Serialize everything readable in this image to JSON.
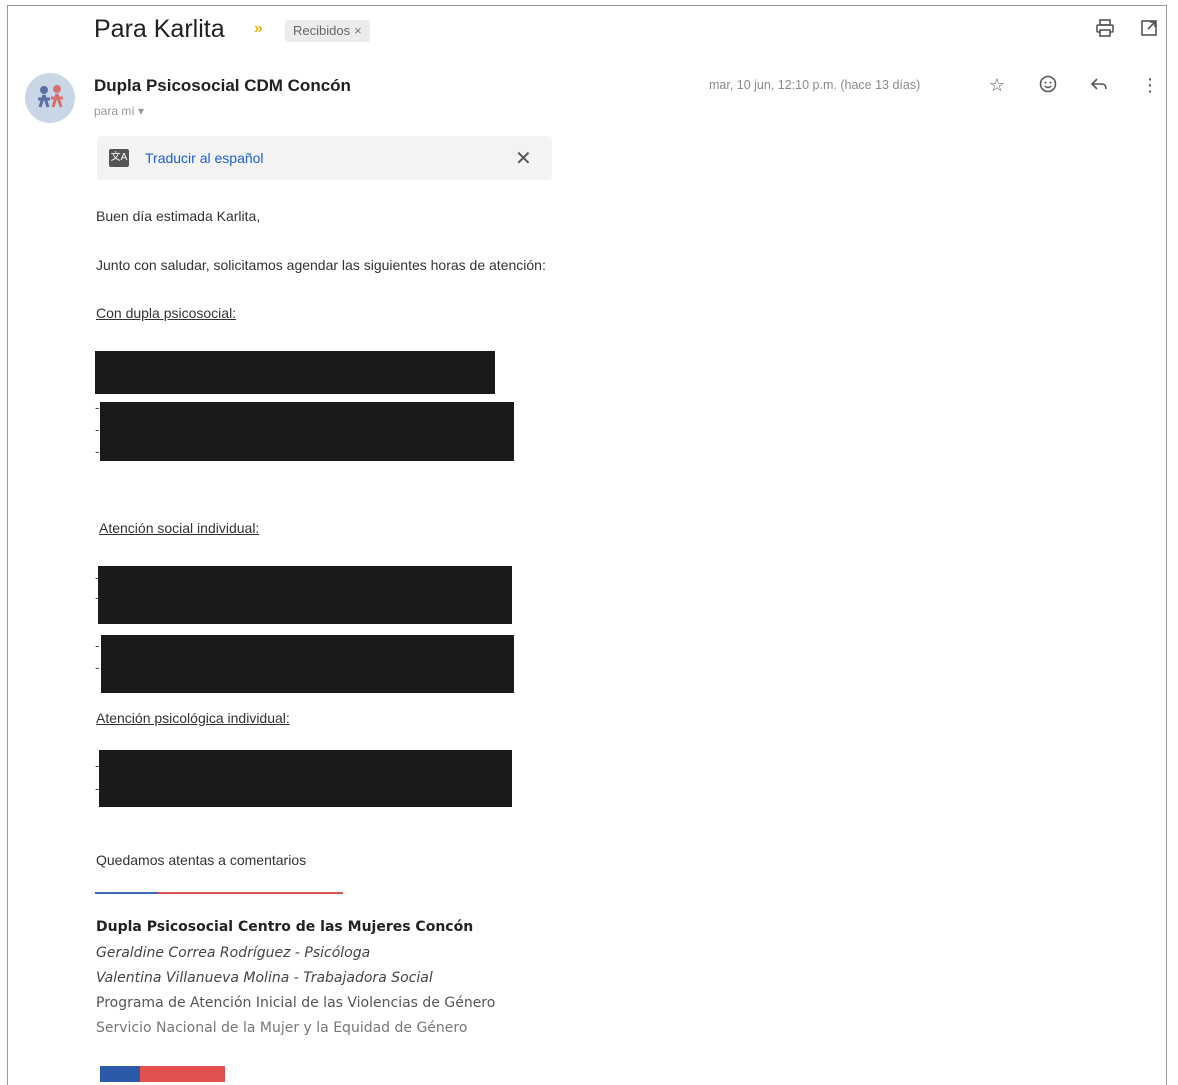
{
  "email": {
    "subject": "Para Karlita",
    "label": "Recibidos",
    "label_close": "×",
    "sender": "Dupla Psicosocial CDM Concón",
    "recipient": "para mí",
    "date": "mar, 10 jun, 12:10 p.m. (hace 13 días)"
  },
  "translate": {
    "link": "Traducir al español",
    "close": "✕"
  },
  "body": {
    "greeting": "Buen día estimada Karlita,",
    "intro": "Junto con saludar, solicitamos agendar las siguientes horas de atención:",
    "section1": "Con dupla psicosocial:",
    "section2": "Atención social individual:",
    "section3": "Atención psicológica individual:",
    "closing": "Quedamos atentas a comentarios"
  },
  "signature": {
    "line1": "Dupla Psicosocial Centro de las Mujeres Concón",
    "line2": "Geraldine Correa Rodríguez - Psicóloga",
    "line3": "Valentina Villanueva Molina - Trabajadora Social",
    "line4": "Programa de Atención Inicial de las Violencias de Género",
    "line5": "Servicio Nacional de la Mujer y la Equidad de Género"
  },
  "icons": {
    "print": "print-icon",
    "open_new": "open-in-new-window-icon",
    "star": "star-icon",
    "emoji": "emoji-reaction-icon",
    "reply": "reply-icon",
    "more": "more-options-icon",
    "translate": "translate-icon",
    "label_chevron": "importance-marker-icon"
  }
}
